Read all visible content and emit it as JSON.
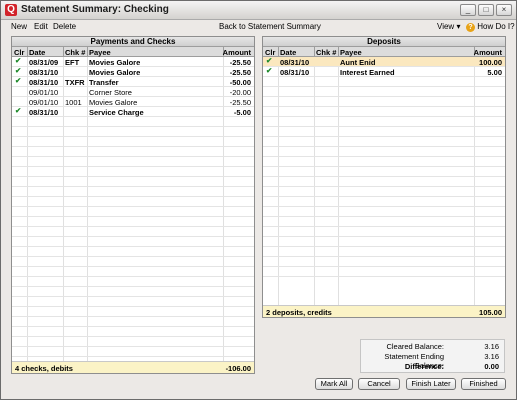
{
  "window": {
    "title": "Statement Summary: Checking",
    "controls": [
      "_",
      "□",
      "×"
    ]
  },
  "menu": {
    "new": "New",
    "edit": "Edit",
    "delete": "Delete",
    "back": "Back to Statement Summary",
    "view": "View",
    "view_arrow": "▾",
    "how_do_i": "How Do I?"
  },
  "payments": {
    "title": "Payments and Checks",
    "columns": {
      "clr": "Clr",
      "date": "Date",
      "chk": "Chk #",
      "payee": "Payee",
      "amount": "Amount"
    },
    "rows": [
      {
        "cleared": "✔",
        "date": "08/31/09",
        "chk": "EFT",
        "payee": "Movies Galore",
        "amount": "-25.50",
        "bold": true
      },
      {
        "cleared": "✔",
        "date": "08/31/10",
        "chk": "",
        "payee": "Movies Galore",
        "amount": "-25.50",
        "bold": true
      },
      {
        "cleared": "✔",
        "date": "08/31/10",
        "chk": "TXFR",
        "payee": "Transfer",
        "amount": "-50.00",
        "bold": true
      },
      {
        "cleared": "",
        "date": "09/01/10",
        "chk": "",
        "payee": "Corner Store",
        "amount": "-20.00",
        "bold": false
      },
      {
        "cleared": "",
        "date": "09/01/10",
        "chk": "1001",
        "payee": "Movies Galore",
        "amount": "-25.50",
        "bold": false
      },
      {
        "cleared": "✔",
        "date": "08/31/10",
        "chk": "",
        "payee": "Service Charge",
        "amount": "-5.00",
        "bold": true
      }
    ],
    "footer_label": "4 checks, debits",
    "footer_total": "-106.00"
  },
  "deposits": {
    "title": "Deposits",
    "columns": {
      "clr": "Clr",
      "date": "Date",
      "chk": "Chk #",
      "payee": "Payee",
      "amount": "Amount"
    },
    "rows": [
      {
        "cleared": "✔",
        "date": "08/31/10",
        "chk": "",
        "payee": "Aunt Enid",
        "amount": "100.00",
        "bold": true
      },
      {
        "cleared": "✔",
        "date": "08/31/10",
        "chk": "",
        "payee": "Interest Earned",
        "amount": "5.00",
        "bold": true
      }
    ],
    "footer_label": "2 deposits, credits",
    "footer_total": "105.00"
  },
  "balances": {
    "cleared_label": "Cleared Balance:",
    "cleared_value": "3.16",
    "ending_label": "Statement Ending Balance:",
    "ending_value": "3.16",
    "difference_label": "Difference:",
    "difference_value": "0.00"
  },
  "buttons": {
    "mark_all": "Mark All",
    "cancel": "Cancel",
    "finish_later": "Finish Later",
    "finished": "Finished"
  },
  "colors": {
    "selected_row": "#fbe8bf",
    "footer": "#fbf3c6",
    "check": "#1e8a2a",
    "app_icon": "#d2232a"
  }
}
